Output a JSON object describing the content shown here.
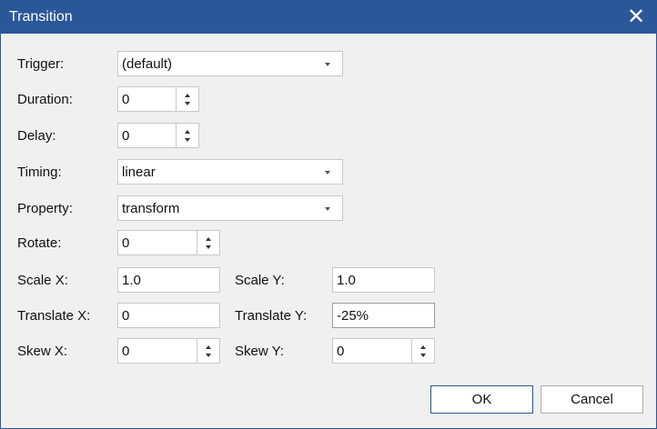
{
  "dialog": {
    "title": "Transition"
  },
  "fields": {
    "trigger": {
      "label": "Trigger:",
      "value": "(default)"
    },
    "duration": {
      "label": "Duration:",
      "value": "0"
    },
    "delay": {
      "label": "Delay:",
      "value": "0"
    },
    "timing": {
      "label": "Timing:",
      "value": "linear"
    },
    "property": {
      "label": "Property:",
      "value": "transform"
    },
    "rotate": {
      "label": "Rotate:",
      "value": "0"
    },
    "scale_x": {
      "label": "Scale X:",
      "value": "1.0"
    },
    "scale_y": {
      "label": "Scale Y:",
      "value": "1.0"
    },
    "translate_x": {
      "label": "Translate X:",
      "value": "0"
    },
    "translate_y": {
      "label": "Translate Y:",
      "value": "-25%"
    },
    "skew_x": {
      "label": "Skew X:",
      "value": "0"
    },
    "skew_y": {
      "label": "Skew Y:",
      "value": "0"
    }
  },
  "buttons": {
    "ok": "OK",
    "cancel": "Cancel"
  },
  "icons": {
    "close": "close-icon",
    "dropdown": "chevron-down-icon",
    "spin_up": "arrow-up-icon",
    "spin_down": "arrow-down-icon"
  },
  "colors": {
    "titlebar": "#2b579a",
    "background": "#f0f0f0"
  }
}
